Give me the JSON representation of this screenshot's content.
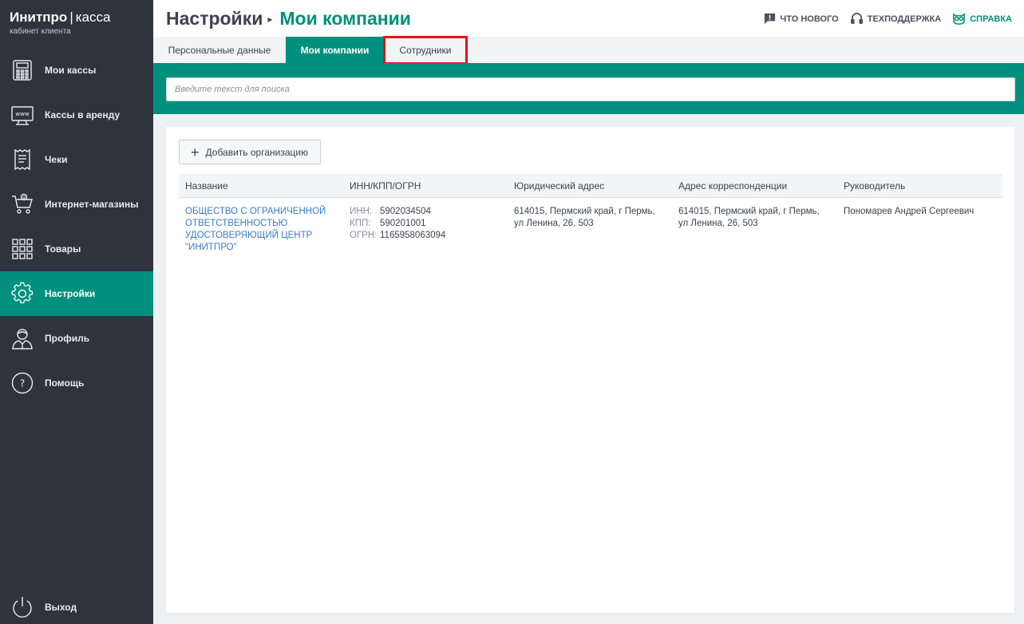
{
  "brand": {
    "name_bold": "Инитпро",
    "separator": "|",
    "name_light": "касса",
    "subtitle": "кабинет клиента"
  },
  "sidebar": {
    "items": [
      {
        "label": "Мои кассы",
        "icon": "cash-register-icon"
      },
      {
        "label": "Кассы в аренду",
        "icon": "www-monitor-icon"
      },
      {
        "label": "Чеки",
        "icon": "receipt-icon"
      },
      {
        "label": "Интернет-магазины",
        "icon": "shopping-cart-icon"
      },
      {
        "label": "Товары",
        "icon": "grid-icon"
      },
      {
        "label": "Настройки",
        "icon": "gear-icon",
        "active": true
      },
      {
        "label": "Профиль",
        "icon": "user-icon"
      },
      {
        "label": "Помощь",
        "icon": "question-icon"
      }
    ],
    "logout": "Выход"
  },
  "header": {
    "title_parent": "Настройки",
    "title_arrow": "▸",
    "title_current": "Мои компании",
    "links": {
      "whats_new": "ЧТО НОВОГО",
      "support": "ТЕХПОДДЕРЖКА",
      "help": "СПРАВКА"
    }
  },
  "tabs": [
    {
      "label": "Персональные данные"
    },
    {
      "label": "Мои компании",
      "active": true
    },
    {
      "label": "Сотрудники",
      "highlighted": true
    }
  ],
  "search": {
    "placeholder": "Введите текст для поиска"
  },
  "companies": {
    "add_button": "Добавить организацию",
    "columns": [
      "Название",
      "ИНН/КПП/ОГРН",
      "Юридический адрес",
      "Адрес корреспонденции",
      "Руководитель"
    ],
    "rows": [
      {
        "name_lines": [
          "ОБЩЕСТВО С ОГРАНИЧЕННОЙ",
          "ОТВЕТСТВЕННОСТЬЮ",
          "УДОСТОВЕРЯЮЩИЙ ЦЕНТР",
          "\"ИНИТПРО\""
        ],
        "inn_label": "ИНН:",
        "inn": "5902034504",
        "kpp_label": "КПП:",
        "kpp": "590201001",
        "ogrn_label": "ОГРН:",
        "ogrn": "1165958063094",
        "legal_address_lines": [
          "614015, Пермский край, г Пермь,",
          "ул Ленина, 26, 503"
        ],
        "mail_address_lines": [
          "614015, Пермский край, г Пермь,",
          "ул Ленина, 26, 503"
        ],
        "director": "Пономарев Андрей Сергеевич"
      }
    ]
  },
  "colors": {
    "accent": "#00907d",
    "sidebar": "#2f333e",
    "link": "#3a7cc2",
    "highlight": "#e41414"
  }
}
